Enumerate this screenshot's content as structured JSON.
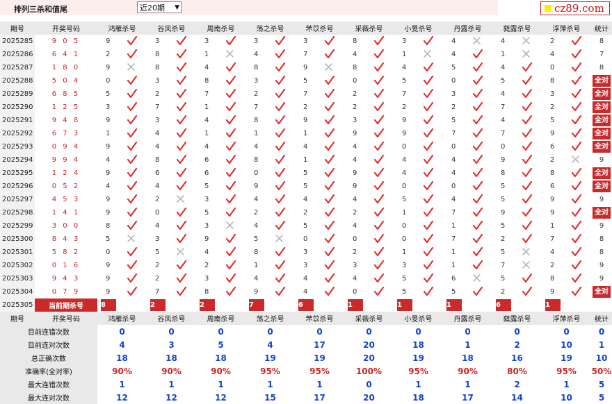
{
  "header": {
    "title": "排列三杀和值尾",
    "period_select": "近20期",
    "logo_text": "cz89.com"
  },
  "columns": [
    "期号",
    "开奖号码",
    "鸿雁杀号",
    "谷风杀号",
    "周南杀号",
    "荡之杀号",
    "芣苡杀号",
    "采薇杀号",
    "小旻杀号",
    "丹露杀号",
    "蕤露杀号",
    "浮萍杀号",
    "统计"
  ],
  "rows": [
    {
      "period": "2025285",
      "draw": "905",
      "kills": [
        [
          "9",
          1
        ],
        [
          "3",
          1
        ],
        [
          "3",
          1
        ],
        [
          "3",
          1
        ],
        [
          "3",
          1
        ],
        [
          "8",
          1
        ],
        [
          "3",
          1
        ],
        [
          "4",
          0
        ],
        [
          "4",
          0
        ],
        [
          "2",
          1
        ]
      ],
      "stat": "8"
    },
    {
      "period": "2025286",
      "draw": "641",
      "kills": [
        [
          "2",
          1
        ],
        [
          "8",
          1
        ],
        [
          "1",
          0
        ],
        [
          "4",
          1
        ],
        [
          "7",
          1
        ],
        [
          "4",
          1
        ],
        [
          "1",
          0
        ],
        [
          "4",
          1
        ],
        [
          "1",
          0
        ],
        [
          "4",
          1
        ]
      ],
      "stat": "7"
    },
    {
      "period": "2025287",
      "draw": "180",
      "kills": [
        [
          "9",
          0
        ],
        [
          "8",
          1
        ],
        [
          "4",
          1
        ],
        [
          "8",
          1
        ],
        [
          "9",
          0
        ],
        [
          "8",
          1
        ],
        [
          "4",
          1
        ],
        [
          "5",
          1
        ],
        [
          "4",
          1
        ],
        [
          "0",
          1
        ]
      ],
      "stat": "8"
    },
    {
      "period": "2025288",
      "draw": "504",
      "kills": [
        [
          "0",
          1
        ],
        [
          "3",
          1
        ],
        [
          "8",
          1
        ],
        [
          "3",
          1
        ],
        [
          "5",
          1
        ],
        [
          "0",
          1
        ],
        [
          "5",
          1
        ],
        [
          "0",
          1
        ],
        [
          "5",
          1
        ],
        [
          "8",
          1
        ]
      ],
      "stat": "全对"
    },
    {
      "period": "2025289",
      "draw": "685",
      "kills": [
        [
          "5",
          1
        ],
        [
          "2",
          1
        ],
        [
          "7",
          1
        ],
        [
          "2",
          1
        ],
        [
          "7",
          1
        ],
        [
          "2",
          1
        ],
        [
          "7",
          1
        ],
        [
          "3",
          1
        ],
        [
          "4",
          1
        ],
        [
          "3",
          1
        ]
      ],
      "stat": "全对"
    },
    {
      "period": "2025290",
      "draw": "125",
      "kills": [
        [
          "3",
          1
        ],
        [
          "7",
          1
        ],
        [
          "1",
          1
        ],
        [
          "7",
          1
        ],
        [
          "2",
          1
        ],
        [
          "2",
          1
        ],
        [
          "2",
          1
        ],
        [
          "2",
          1
        ],
        [
          "7",
          1
        ],
        [
          "2",
          1
        ]
      ],
      "stat": "全对"
    },
    {
      "period": "2025291",
      "draw": "948",
      "kills": [
        [
          "9",
          1
        ],
        [
          "3",
          1
        ],
        [
          "4",
          1
        ],
        [
          "8",
          1
        ],
        [
          "9",
          1
        ],
        [
          "3",
          1
        ],
        [
          "9",
          1
        ],
        [
          "5",
          1
        ],
        [
          "4",
          1
        ],
        [
          "5",
          1
        ]
      ],
      "stat": "全对"
    },
    {
      "period": "2025292",
      "draw": "673",
      "kills": [
        [
          "1",
          1
        ],
        [
          "4",
          1
        ],
        [
          "1",
          1
        ],
        [
          "1",
          1
        ],
        [
          "1",
          1
        ],
        [
          "9",
          1
        ],
        [
          "9",
          1
        ],
        [
          "7",
          1
        ],
        [
          "7",
          1
        ],
        [
          "9",
          1
        ]
      ],
      "stat": "全对"
    },
    {
      "period": "2025293",
      "draw": "094",
      "kills": [
        [
          "9",
          1
        ],
        [
          "4",
          1
        ],
        [
          "4",
          1
        ],
        [
          "4",
          1
        ],
        [
          "4",
          1
        ],
        [
          "4",
          1
        ],
        [
          "0",
          1
        ],
        [
          "0",
          1
        ],
        [
          "0",
          1
        ],
        [
          "6",
          1
        ]
      ],
      "stat": "全对"
    },
    {
      "period": "2025294",
      "draw": "994",
      "kills": [
        [
          "4",
          1
        ],
        [
          "8",
          1
        ],
        [
          "6",
          1
        ],
        [
          "8",
          1
        ],
        [
          "1",
          1
        ],
        [
          "4",
          1
        ],
        [
          "4",
          1
        ],
        [
          "4",
          1
        ],
        [
          "9",
          1
        ],
        [
          "2",
          0
        ]
      ],
      "stat": "9"
    },
    {
      "period": "2025295",
      "draw": "124",
      "kills": [
        [
          "9",
          1
        ],
        [
          "6",
          1
        ],
        [
          "6",
          1
        ],
        [
          "0",
          1
        ],
        [
          "5",
          1
        ],
        [
          "9",
          1
        ],
        [
          "4",
          1
        ],
        [
          "4",
          1
        ],
        [
          "8",
          1
        ],
        [
          "8",
          1
        ]
      ],
      "stat": "全对"
    },
    {
      "period": "2025296",
      "draw": "052",
      "kills": [
        [
          "4",
          1
        ],
        [
          "4",
          1
        ],
        [
          "5",
          1
        ],
        [
          "9",
          1
        ],
        [
          "5",
          1
        ],
        [
          "9",
          1
        ],
        [
          "0",
          1
        ],
        [
          "0",
          1
        ],
        [
          "5",
          1
        ],
        [
          "6",
          1
        ]
      ],
      "stat": "全对"
    },
    {
      "period": "2025297",
      "draw": "453",
      "kills": [
        [
          "9",
          1
        ],
        [
          "2",
          0
        ],
        [
          "3",
          1
        ],
        [
          "4",
          1
        ],
        [
          "4",
          1
        ],
        [
          "4",
          1
        ],
        [
          "5",
          1
        ],
        [
          "4",
          1
        ],
        [
          "5",
          1
        ],
        [
          "9",
          1
        ]
      ],
      "stat": "9"
    },
    {
      "period": "2025298",
      "draw": "141",
      "kills": [
        [
          "9",
          1
        ],
        [
          "0",
          1
        ],
        [
          "5",
          1
        ],
        [
          "2",
          1
        ],
        [
          "2",
          1
        ],
        [
          "2",
          1
        ],
        [
          "1",
          1
        ],
        [
          "7",
          1
        ],
        [
          "9",
          1
        ],
        [
          "9",
          1
        ]
      ],
      "stat": "全对"
    },
    {
      "period": "2025299",
      "draw": "300",
      "kills": [
        [
          "8",
          1
        ],
        [
          "4",
          1
        ],
        [
          "3",
          0
        ],
        [
          "4",
          1
        ],
        [
          "5",
          1
        ],
        [
          "4",
          1
        ],
        [
          "0",
          1
        ],
        [
          "1",
          1
        ],
        [
          "5",
          1
        ],
        [
          "1",
          1
        ]
      ],
      "stat": "9"
    },
    {
      "period": "2025300",
      "draw": "843",
      "kills": [
        [
          "5",
          0
        ],
        [
          "3",
          1
        ],
        [
          "9",
          1
        ],
        [
          "5",
          0
        ],
        [
          "0",
          1
        ],
        [
          "0",
          1
        ],
        [
          "0",
          1
        ],
        [
          "7",
          1
        ],
        [
          "2",
          1
        ],
        [
          "7",
          1
        ]
      ],
      "stat": "8"
    },
    {
      "period": "2025301",
      "draw": "582",
      "kills": [
        [
          "0",
          1
        ],
        [
          "5",
          0
        ],
        [
          "4",
          1
        ],
        [
          "8",
          1
        ],
        [
          "3",
          1
        ],
        [
          "2",
          1
        ],
        [
          "1",
          1
        ],
        [
          "1",
          1
        ],
        [
          "5",
          0
        ],
        [
          "4",
          1
        ]
      ],
      "stat": "8"
    },
    {
      "period": "2025302",
      "draw": "016",
      "kills": [
        [
          "9",
          1
        ],
        [
          "2",
          1
        ],
        [
          "2",
          1
        ],
        [
          "1",
          1
        ],
        [
          "3",
          1
        ],
        [
          "3",
          1
        ],
        [
          "3",
          1
        ],
        [
          "1",
          1
        ],
        [
          "7",
          0
        ],
        [
          "2",
          1
        ]
      ],
      "stat": "9"
    },
    {
      "period": "2025303",
      "draw": "943",
      "kills": [
        [
          "9",
          1
        ],
        [
          "2",
          1
        ],
        [
          "3",
          1
        ],
        [
          "4",
          1
        ],
        [
          "4",
          1
        ],
        [
          "4",
          1
        ],
        [
          "5",
          1
        ],
        [
          "6",
          0
        ],
        [
          "5",
          1
        ],
        [
          "8",
          1
        ]
      ],
      "stat": "9"
    },
    {
      "period": "2025304",
      "draw": "079",
      "kills": [
        [
          "9",
          1
        ],
        [
          "7",
          1
        ],
        [
          "8",
          1
        ],
        [
          "9",
          1
        ],
        [
          "4",
          1
        ],
        [
          "0",
          1
        ],
        [
          "5",
          1
        ],
        [
          "5",
          1
        ],
        [
          "2",
          1
        ],
        [
          "9",
          1
        ]
      ],
      "stat": "全对"
    }
  ],
  "current": {
    "period": "2025305",
    "label": "当前期杀号",
    "kills": [
      "8",
      "2",
      "2",
      "7",
      "6",
      "1",
      "1",
      "1",
      "6",
      "1"
    ]
  },
  "stats": [
    {
      "label": "目前连错次数",
      "values": [
        "0",
        "0",
        "0",
        "0",
        "0",
        "0",
        "0",
        "0",
        "0",
        "0",
        "0"
      ],
      "pct": false
    },
    {
      "label": "目前连对次数",
      "values": [
        "4",
        "3",
        "5",
        "4",
        "17",
        "20",
        "18",
        "1",
        "2",
        "10",
        "1"
      ],
      "pct": false
    },
    {
      "label": "总正确次数",
      "values": [
        "18",
        "18",
        "18",
        "19",
        "19",
        "20",
        "19",
        "18",
        "16",
        "19",
        "10"
      ],
      "pct": false
    },
    {
      "label": "准确率(全对率)",
      "values": [
        "90%",
        "90%",
        "90%",
        "95%",
        "95%",
        "100%",
        "95%",
        "90%",
        "80%",
        "95%",
        "50%"
      ],
      "pct": true
    },
    {
      "label": "最大连错次数",
      "values": [
        "1",
        "1",
        "1",
        "1",
        "1",
        "0",
        "1",
        "1",
        "2",
        "1",
        "5"
      ],
      "pct": false
    },
    {
      "label": "最大连对次数",
      "values": [
        "12",
        "12",
        "12",
        "15",
        "17",
        "20",
        "18",
        "17",
        "14",
        "10",
        "5"
      ],
      "pct": false
    }
  ],
  "colors": {
    "accent": "#cc2a2a",
    "stat_blue": "#1144cc",
    "header_bg": "#e9e9e9",
    "mark_bg": "#fbf8e8"
  }
}
